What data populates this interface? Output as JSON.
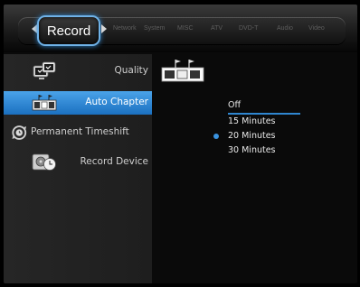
{
  "topnav": {
    "active_tab": "Record",
    "other_tabs": [
      "Network",
      "System",
      "MISC",
      "ATV",
      "DVD-T",
      "Audio",
      "Video"
    ]
  },
  "menu": {
    "items": [
      {
        "label": "Quality",
        "icon": "tv-quality-icon",
        "selected": false
      },
      {
        "label": "Auto Chapter",
        "icon": "filmstrip-chapter-icon",
        "selected": true
      },
      {
        "label": "Permanent Timeshift",
        "icon": "circular-arrows-clock-icon",
        "selected": false
      },
      {
        "label": "Record Device",
        "icon": "hard-drive-clock-icon",
        "selected": false
      }
    ]
  },
  "options": {
    "items": [
      "Off",
      "15 Minutes",
      "20 Minutes",
      "30 Minutes"
    ],
    "focused": "Off",
    "selected": "20 Minutes"
  },
  "colors": {
    "accent_blue": "#2f86cf",
    "highlight_start": "#4aa3e9",
    "highlight_end": "#1b70c0"
  }
}
